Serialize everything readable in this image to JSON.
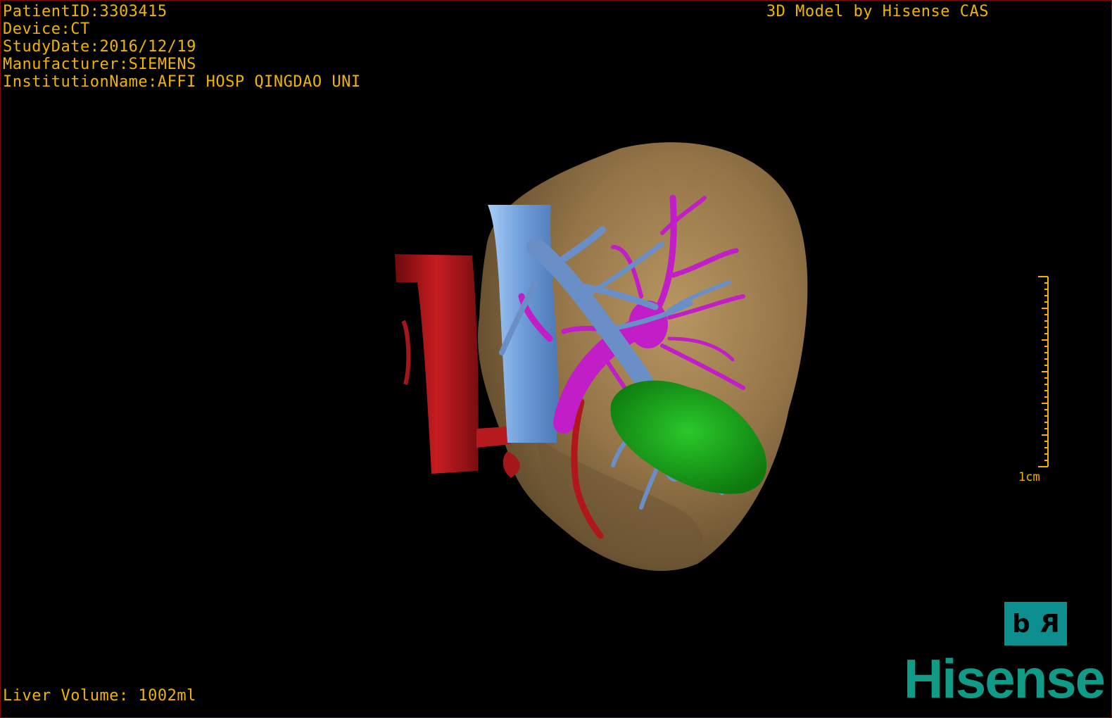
{
  "overlay": {
    "patient_id": "PatientID:3303415",
    "device": "Device:CT",
    "study_date": "StudyDate:2016/12/19",
    "manufacturer": "Manufacturer:SIEMENS",
    "institution": "InstitutionName:AFFI HOSP QINGDAO UNI",
    "brand_title": "3D Model by Hisense CAS",
    "liver_volume": "Liver Volume: 1002ml"
  },
  "scale": {
    "label": "1cm"
  },
  "orientation": {
    "left": "d",
    "right": "R"
  },
  "logo": {
    "text": "Hisense"
  },
  "colors": {
    "text": "#f0b400",
    "liver": "#9a7a4e",
    "artery": "#b0171b",
    "portal_vein": "#c21ec8",
    "hepatic_vein": "#6a8fc6",
    "ivc": "#8db4e6",
    "lesion": "#16a716",
    "brand": "#0f9b86"
  }
}
